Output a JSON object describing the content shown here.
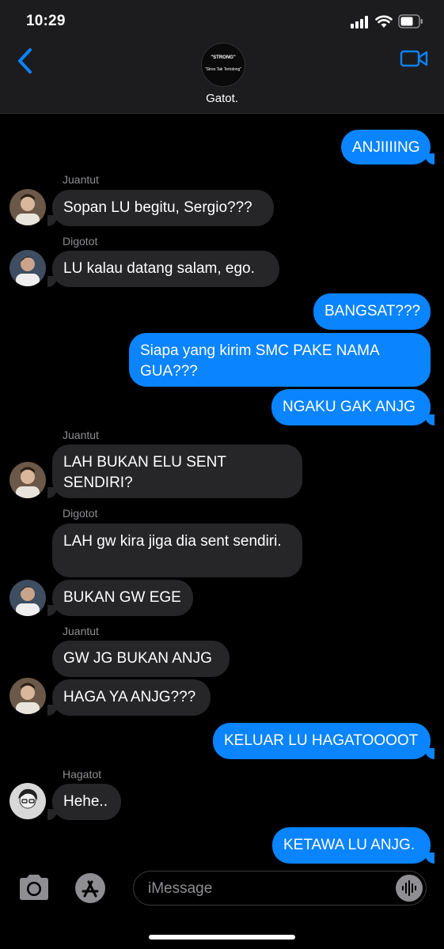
{
  "status_bar": {
    "time": "10:29"
  },
  "header": {
    "avatar_line1": "\"STRONG\"",
    "avatar_line2": "\"Stres Tak Tertolong\"",
    "title": "Gatot."
  },
  "messages": [
    {
      "text": "ANJIIIING"
    },
    {
      "sender": "Juantut",
      "text": "Sopan LU begitu, Sergio???"
    },
    {
      "sender": "Digotot",
      "text": "LU kalau datang salam, ego."
    },
    {
      "text": "BANGSAT???"
    },
    {
      "text": "Siapa yang kirim SMC PAKE NAMA GUA???"
    },
    {
      "text": "NGAKU GAK ANJG"
    },
    {
      "sender": "Juantut",
      "text": "LAH BUKAN ELU SENT SENDIRI?"
    },
    {
      "sender": "Digotot",
      "text": "LAH gw kira jiga dia sent sendiri."
    },
    {
      "text": "BUKAN GW EGE"
    },
    {
      "sender": "Juantut",
      "text": "GW JG BUKAN ANJG"
    },
    {
      "text": "HAGA YA ANJG???"
    },
    {
      "text": "KELUAR LU HAGATOOOOT"
    },
    {
      "sender": "Hagatot",
      "text": "Hehe.."
    },
    {
      "text": "KETAWA LU ANJG."
    }
  ],
  "composer": {
    "placeholder": "iMessage"
  },
  "colors": {
    "outgoing": "#0a84ff",
    "incoming": "#262629",
    "accent": "#0a84ff"
  }
}
